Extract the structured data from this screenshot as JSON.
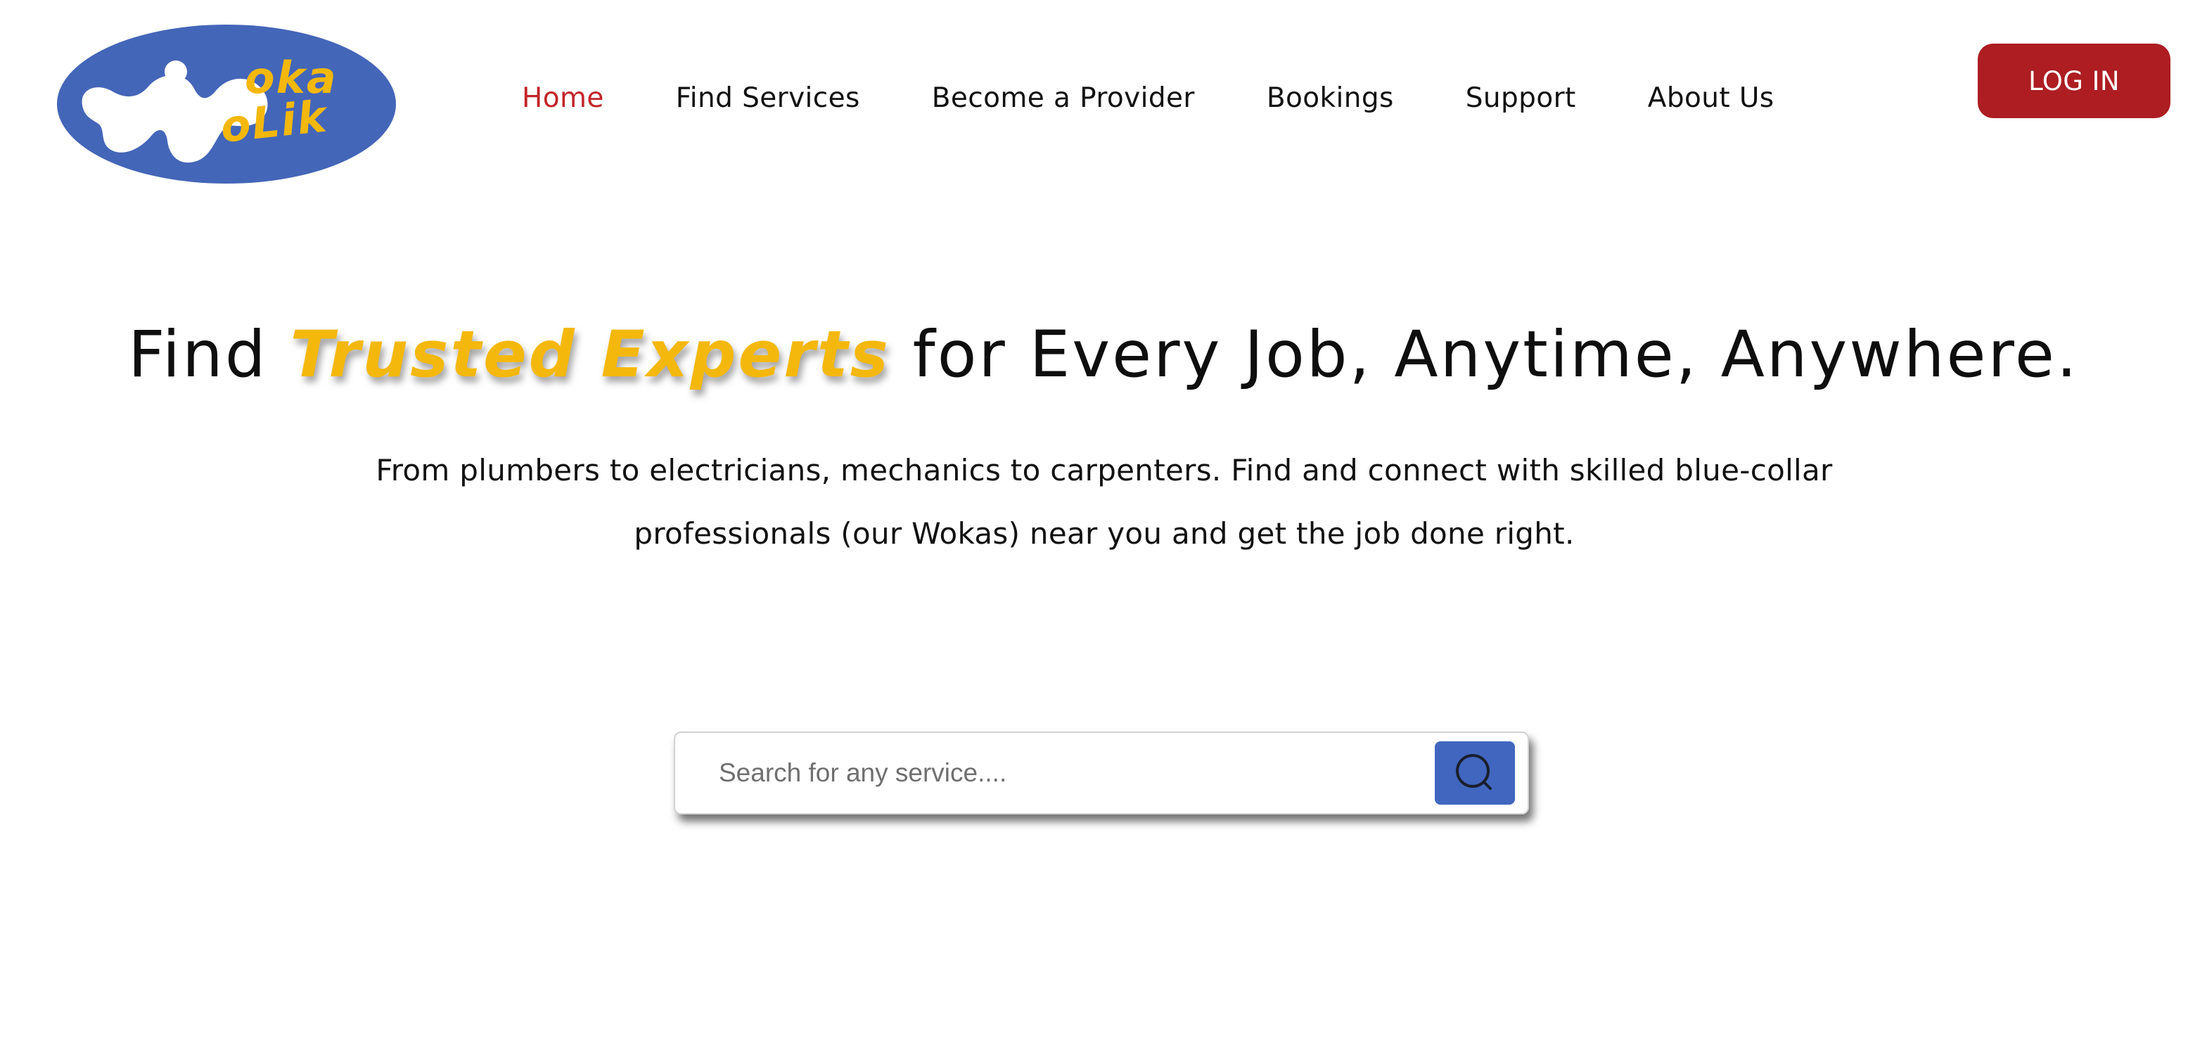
{
  "brand": {
    "logo_text": "WokaWoLik",
    "logo_bg_color": "#4466b8",
    "logo_accent_color": "#f4b80c"
  },
  "nav": {
    "items": [
      {
        "label": "Home",
        "active": true
      },
      {
        "label": "Find Services",
        "active": false
      },
      {
        "label": "Become a Provider",
        "active": false
      },
      {
        "label": "Bookings",
        "active": false
      },
      {
        "label": "Support",
        "active": false
      },
      {
        "label": "About Us",
        "active": false
      }
    ],
    "active_color": "#c2252a"
  },
  "header": {
    "login_label": "LOG IN",
    "login_color": "#ad1d22"
  },
  "hero": {
    "title_prefix": "Find ",
    "title_highlight": "Trusted Experts",
    "title_suffix": " for Every Job, Anytime, Anywhere.",
    "highlight_color": "#f4b80c",
    "subtitle": "From plumbers to electricians, mechanics to carpenters. Find and connect with skilled blue-collar professionals (our Wokas) near you and get the job done right."
  },
  "search": {
    "placeholder": "Search for any service....",
    "value": "",
    "button_icon": "search-icon",
    "button_color": "#4166bf"
  }
}
